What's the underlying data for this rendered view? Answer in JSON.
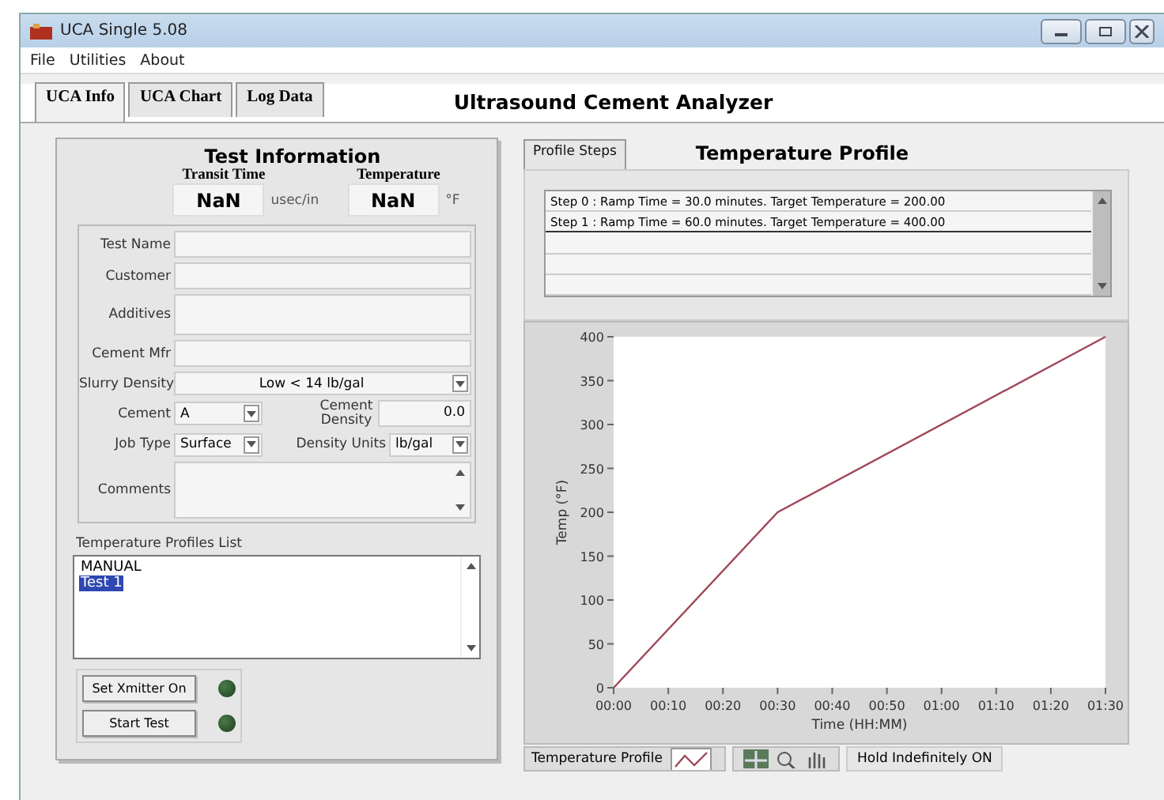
{
  "window": {
    "title": "UCA Single 5.08"
  },
  "menu": [
    "File",
    "Utilities",
    "About"
  ],
  "tabs": [
    {
      "label": "UCA Info",
      "selected": true
    },
    {
      "label": "UCA Chart",
      "selected": false
    },
    {
      "label": "Log Data",
      "selected": false
    }
  ],
  "app_title": "Ultrasound Cement Analyzer",
  "test_info": {
    "title": "Test Information",
    "readouts": [
      {
        "label": "Transit Time",
        "value": "NaN",
        "unit": "usec/in"
      },
      {
        "label": "Temperature",
        "value": "NaN",
        "unit": "°F"
      }
    ],
    "form_rows": [
      [
        {
          "kind": "text",
          "label": "Test Name"
        }
      ],
      [
        {
          "kind": "text",
          "label": "Customer"
        }
      ],
      [
        {
          "kind": "textarea",
          "label": "Additives"
        }
      ],
      [
        {
          "kind": "text",
          "label": "Cement Mfr"
        }
      ],
      [
        {
          "kind": "dropdown",
          "label": "Slurry Density",
          "value": "Low < 14 lb/gal"
        }
      ],
      [
        {
          "kind": "dropdown",
          "label": "Cement",
          "value": "A"
        },
        {
          "kind": "number",
          "label": "Cement Density",
          "value": "0.0"
        }
      ],
      [
        {
          "kind": "dropdown",
          "label": "Job Type",
          "value": "Surface"
        },
        {
          "kind": "dropdown",
          "label": "Density Units",
          "value": "lb/gal"
        }
      ],
      [
        {
          "kind": "scrolltext",
          "label": "Comments"
        }
      ]
    ]
  },
  "profiles": {
    "label": "Temperature Profiles List",
    "items": [
      {
        "label": "MANUAL",
        "selected": false
      },
      {
        "label": "Test 1",
        "selected": true
      }
    ]
  },
  "controls": [
    {
      "label": "Set Xmitter On",
      "on": false
    },
    {
      "label": "Start Test",
      "on": false
    }
  ],
  "profile_tabs": [
    {
      "label": "Profile Steps",
      "selected": true
    }
  ],
  "profile_title": "Temperature Profile",
  "steps": [
    "Step 0 : Ramp Time = 30.0 minutes.  Target Temperature = 200.00",
    "Step 1 : Ramp Time = 60.0 minutes.  Target Temperature = 400.00"
  ],
  "chart": {
    "chart_data": {
      "type": "line",
      "xlabel": "Time (HH:MM)",
      "ylabel": "Temp (°F)",
      "x": [
        0,
        30,
        90
      ],
      "series": [
        {
          "name": "Temperature Profile",
          "color": "#a04858",
          "values": [
            0,
            200,
            400
          ]
        }
      ],
      "xlim": [
        0,
        90
      ],
      "ylim": [
        0,
        400
      ],
      "xticks": [
        {
          "value": 0,
          "label": "00:00"
        },
        {
          "value": 10,
          "label": "00:10"
        },
        {
          "value": 20,
          "label": "00:20"
        },
        {
          "value": 30,
          "label": "00:30"
        },
        {
          "value": 40,
          "label": "00:40"
        },
        {
          "value": 50,
          "label": "00:50"
        },
        {
          "value": 60,
          "label": "01:00"
        },
        {
          "value": 70,
          "label": "01:10"
        },
        {
          "value": 80,
          "label": "01:20"
        },
        {
          "value": 90,
          "label": "01:30"
        }
      ],
      "yticks": [
        0,
        50,
        100,
        150,
        200,
        250,
        300,
        350,
        400
      ]
    }
  },
  "status": "Hold Indefinitely ON"
}
